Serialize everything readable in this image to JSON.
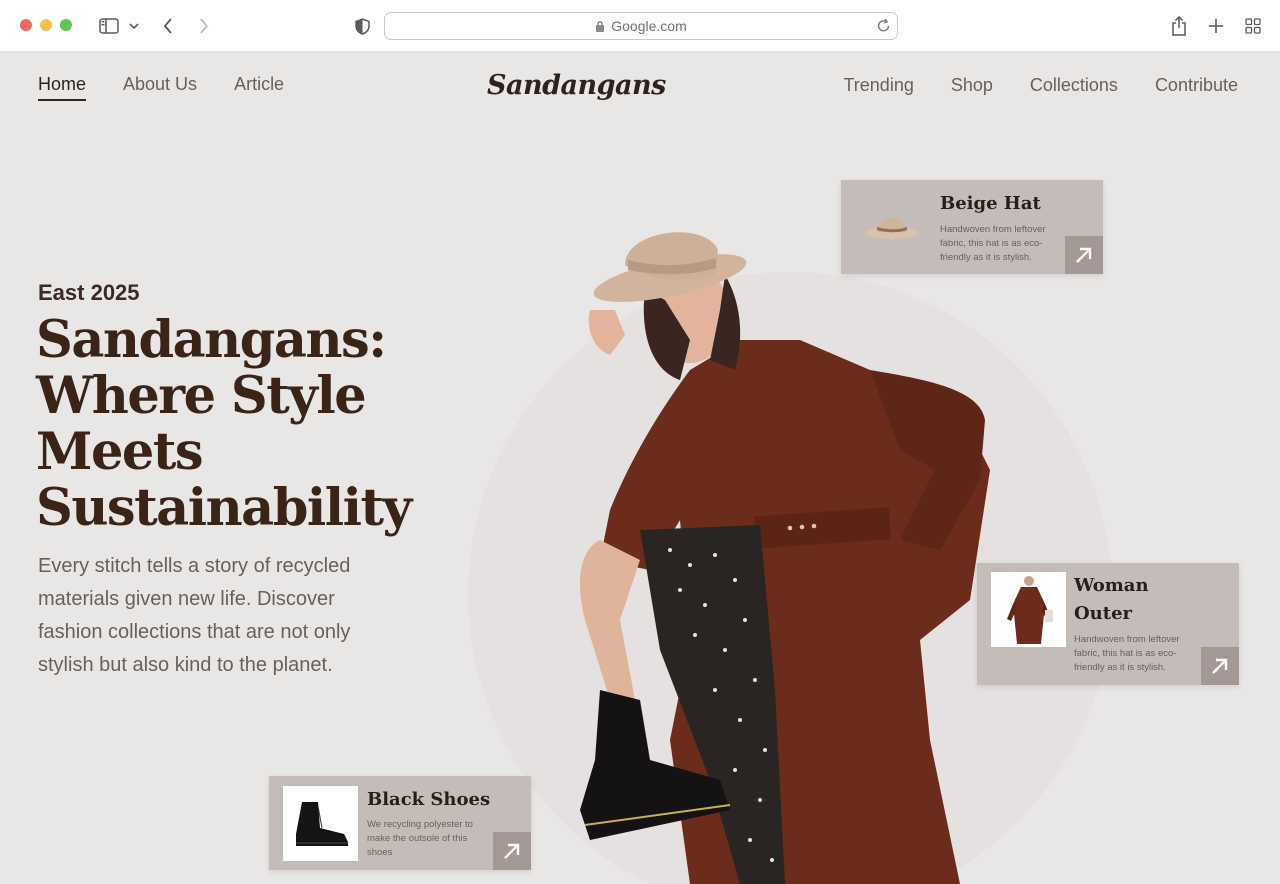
{
  "browser": {
    "url": "Google.com",
    "icons": [
      "sidebar-icon",
      "chevron-down-icon",
      "back-icon",
      "forward-icon",
      "shield-icon",
      "lock-icon",
      "reload-icon",
      "share-icon",
      "plus-icon",
      "tabs-grid-icon"
    ]
  },
  "nav": {
    "left": [
      {
        "label": "Home",
        "active": true
      },
      {
        "label": "About Us",
        "active": false
      },
      {
        "label": "Article",
        "active": false
      }
    ],
    "brand": "Sandangans",
    "right": [
      {
        "label": "Trending"
      },
      {
        "label": "Shop"
      },
      {
        "label": "Collections"
      },
      {
        "label": "Contribute"
      }
    ]
  },
  "hero": {
    "eyebrow": "East 2025",
    "headline": "Sandangans: Where Style Meets Sustainability",
    "subtext": "Every stitch tells a story of recycled materials given new life. Discover fashion collections that are not only stylish but also kind to the planet."
  },
  "cards": {
    "hat": {
      "title": "Beige Hat",
      "desc": "Handwoven from leftover fabric, this hat is as eco-friendly as it is stylish."
    },
    "outer": {
      "title": "Woman Outer",
      "desc": "Handwoven from leftover fabric, this hat is as eco-friendly as it is stylish."
    },
    "shoes": {
      "title": "Black Shoes",
      "desc": "We recycling polyester to make the outsole of this shoes"
    }
  },
  "colors": {
    "page_bg": "#e9e7e6",
    "card_bg": "#c4bcb8",
    "arrow_bg": "#a39893",
    "coat": "#6b2c1c",
    "heading": "#3a2418"
  }
}
